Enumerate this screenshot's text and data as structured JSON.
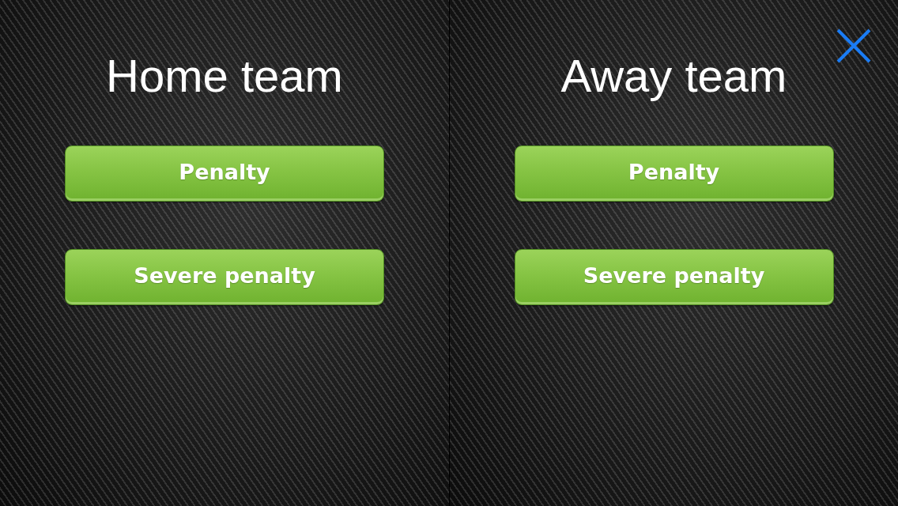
{
  "panels": [
    {
      "title": "Home team",
      "buttons": [
        {
          "label": "Penalty"
        },
        {
          "label": "Severe penalty"
        }
      ]
    },
    {
      "title": "Away team",
      "buttons": [
        {
          "label": "Penalty"
        },
        {
          "label": "Severe penalty"
        }
      ]
    }
  ]
}
